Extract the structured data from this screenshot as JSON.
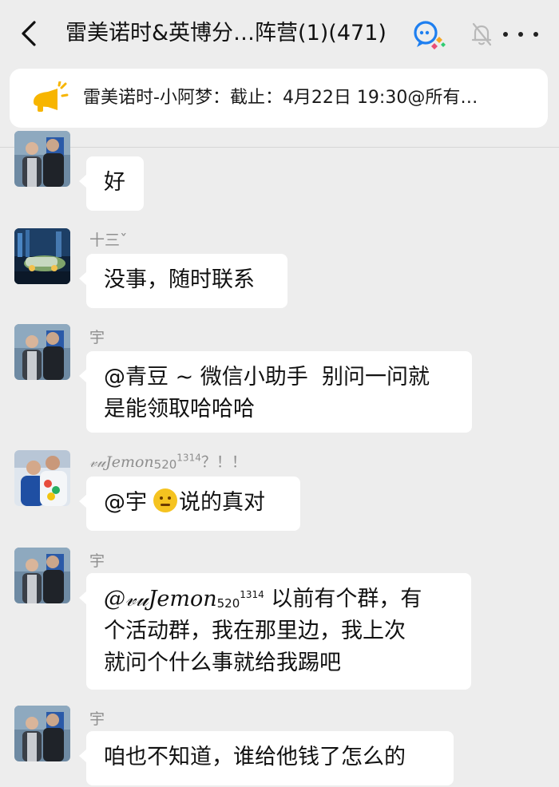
{
  "header": {
    "title": "雷美诺时&英博分…阵营(1)(471)",
    "back_icon": "chevron-left-icon",
    "group_icon": "group-chat-icon",
    "mute_icon": "bell-off-icon",
    "more_icon": "more-dots-icon"
  },
  "announcement": {
    "icon": "megaphone-icon",
    "text": "雷美诺时-小阿梦：截止：4月22日 19:30@所有…"
  },
  "messages": [
    {
      "sender": "",
      "text": "好"
    },
    {
      "sender": "十三ˇ",
      "text": "没事，随时联系"
    },
    {
      "sender": "宇",
      "line1": "@青豆 ~ 微信小助手  别问一问就",
      "line2": "是能领取哈哈哈"
    },
    {
      "sender_name": "𝓋𝓊Jemon",
      "sender_sub": "520",
      "sender_sup": "1314",
      "sender_suffix": "？！！",
      "text_before": "@宇",
      "text_after": "说的真对"
    },
    {
      "sender": "宇",
      "mention_name": "@𝓋𝓊Jemon",
      "mention_sub": "520",
      "mention_sup": "1314",
      "line1_rest": " 以前有个群，有",
      "line2": "个活动群，我在那里边，我上次",
      "line3": "就问个什么事就给我踢吧"
    },
    {
      "sender": "宇",
      "text": "咱也不知道，谁给他钱了怎么的"
    }
  ]
}
